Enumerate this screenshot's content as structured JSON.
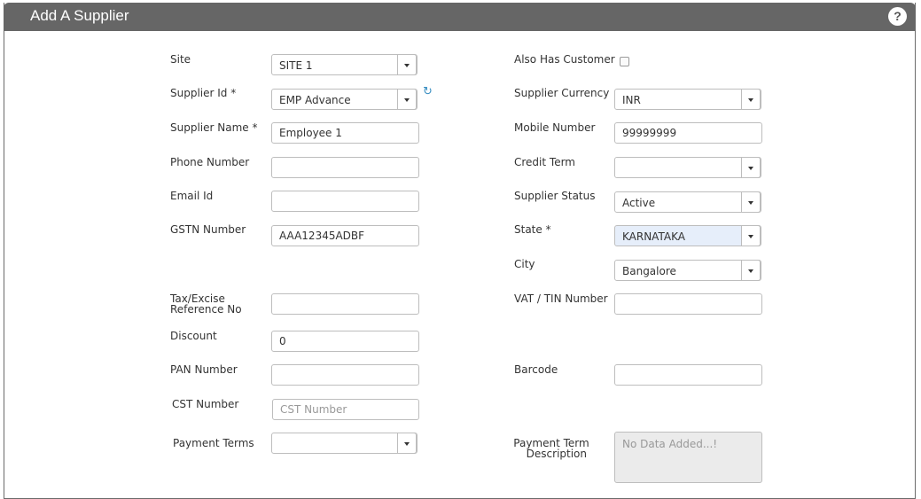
{
  "header": {
    "title": "Add A Supplier",
    "help_icon": "?"
  },
  "left": {
    "site": {
      "label": "Site",
      "value": "SITE 1"
    },
    "supplier_id": {
      "label": "Supplier Id *",
      "value": "EMP Advance"
    },
    "supplier_name": {
      "label": "Supplier Name *",
      "value": "Employee 1"
    },
    "phone_number": {
      "label": "Phone Number",
      "value": ""
    },
    "email_id": {
      "label": "Email Id",
      "value": ""
    },
    "gstn_number": {
      "label": "GSTN Number",
      "value": "AAA12345ADBF"
    },
    "tax_ref": {
      "label_line1": "Tax/Excise",
      "label_line2": "Reference No",
      "value": ""
    },
    "discount": {
      "label": "Discount",
      "value": "0"
    },
    "pan_number": {
      "label": "PAN Number",
      "value": ""
    },
    "cst_number": {
      "label": "CST Number",
      "placeholder": "CST Number"
    },
    "payment_terms": {
      "label": "Payment Terms",
      "value": ""
    }
  },
  "right": {
    "also_has_customer": {
      "label": "Also Has Customer",
      "checked": false
    },
    "supplier_currency": {
      "label": "Supplier Currency",
      "value": "INR"
    },
    "mobile_number": {
      "label": "Mobile Number",
      "value": "99999999"
    },
    "credit_term": {
      "label": "Credit Term",
      "value": ""
    },
    "supplier_status": {
      "label": "Supplier Status",
      "value": "Active"
    },
    "state": {
      "label": "State *",
      "value": "KARNATAKA"
    },
    "city": {
      "label": "City",
      "value": "Bangalore"
    },
    "vat_tin": {
      "label": "VAT / TIN Number",
      "value": ""
    },
    "barcode": {
      "label": "Barcode",
      "value": ""
    },
    "payment_term_description": {
      "label_line1": "Payment Term",
      "label_line2": "Description",
      "value": "No Data Added...!"
    }
  },
  "colors": {
    "header_bg": "#666666",
    "highlight_select": "#e6eefa",
    "refresh_icon": "#3a8fc2"
  }
}
